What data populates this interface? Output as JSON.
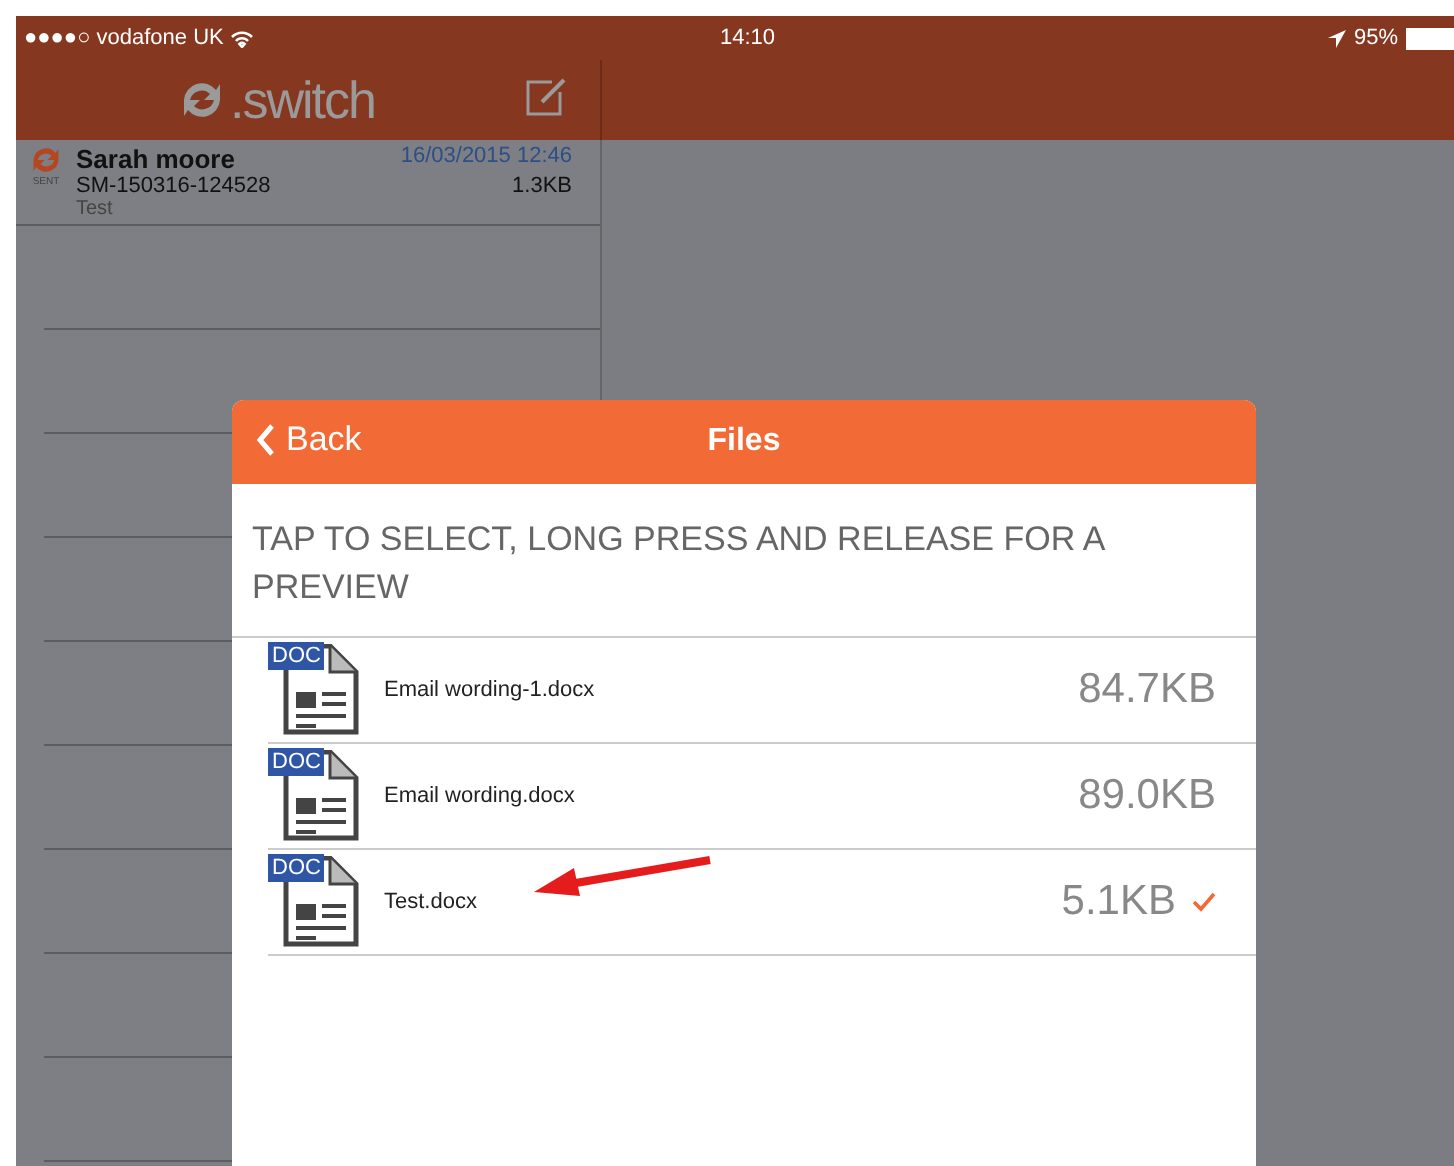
{
  "status_bar": {
    "carrier": "●●●●○ vodafone UK",
    "time": "14:10",
    "battery": "95%"
  },
  "app_header": {
    "logo": ".switch"
  },
  "messages": [
    {
      "name": "Sarah moore",
      "date": "16/03/2015 12:46",
      "reference": "SM-150316-124528",
      "size": "1.3KB",
      "subject": "Test",
      "status": "SENT"
    }
  ],
  "files_dialog": {
    "back": "Back",
    "title": "Files",
    "instruction": "TAP TO SELECT, LONG PRESS AND RELEASE FOR A PREVIEW",
    "files": [
      {
        "badge": "DOC",
        "name": "Email wording-1.docx",
        "size": "84.7KB",
        "selected": false
      },
      {
        "badge": "DOC",
        "name": "Email wording.docx",
        "size": "89.0KB",
        "selected": false
      },
      {
        "badge": "DOC",
        "name": "Test.docx",
        "size": "5.1KB",
        "selected": true
      }
    ]
  }
}
